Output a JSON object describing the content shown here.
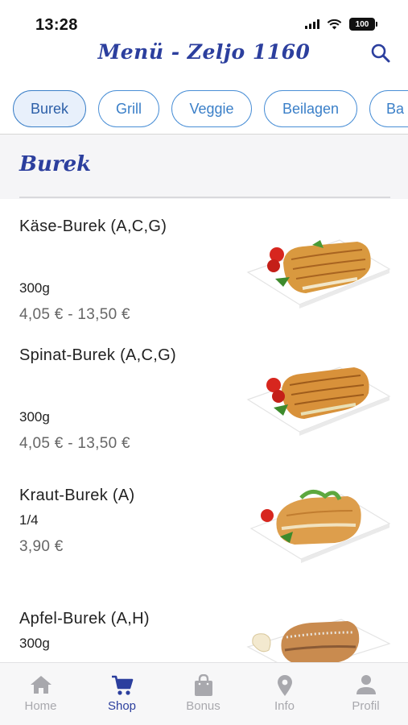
{
  "status_bar": {
    "time": "13:28",
    "battery": "100"
  },
  "header": {
    "title": "Menü - Zeljo 1160",
    "search_icon": "search-icon"
  },
  "categories": [
    {
      "label": "Burek",
      "active": true
    },
    {
      "label": "Grill",
      "active": false
    },
    {
      "label": "Veggie",
      "active": false
    },
    {
      "label": "Beilagen",
      "active": false
    },
    {
      "label": "Ba",
      "active": false
    }
  ],
  "section": {
    "title": "Burek"
  },
  "items": [
    {
      "name": "Käse-Burek (A,C,G)",
      "weight": "300g",
      "price": "4,05 € - 13,50 €"
    },
    {
      "name": "Spinat-Burek (A,C,G)",
      "weight": "300g",
      "price": "4,05 € - 13,50 €"
    },
    {
      "name": "Kraut-Burek (A)",
      "weight": "1/4",
      "price": "3,90 €"
    },
    {
      "name": "Apfel-Burek (A,H)",
      "weight": "300g",
      "price": ""
    }
  ],
  "tabs": [
    {
      "label": "Home",
      "icon": "home-icon",
      "active": false
    },
    {
      "label": "Shop",
      "icon": "cart-icon",
      "active": true
    },
    {
      "label": "Bonus",
      "icon": "bag-icon",
      "active": false
    },
    {
      "label": "Info",
      "icon": "location-pin-icon",
      "active": false
    },
    {
      "label": "Profil",
      "icon": "person-icon",
      "active": false
    }
  ],
  "colors": {
    "brand": "#2c3f9e",
    "chip_border": "#4a8fd6",
    "inactive_tab": "#a8a8ad"
  }
}
